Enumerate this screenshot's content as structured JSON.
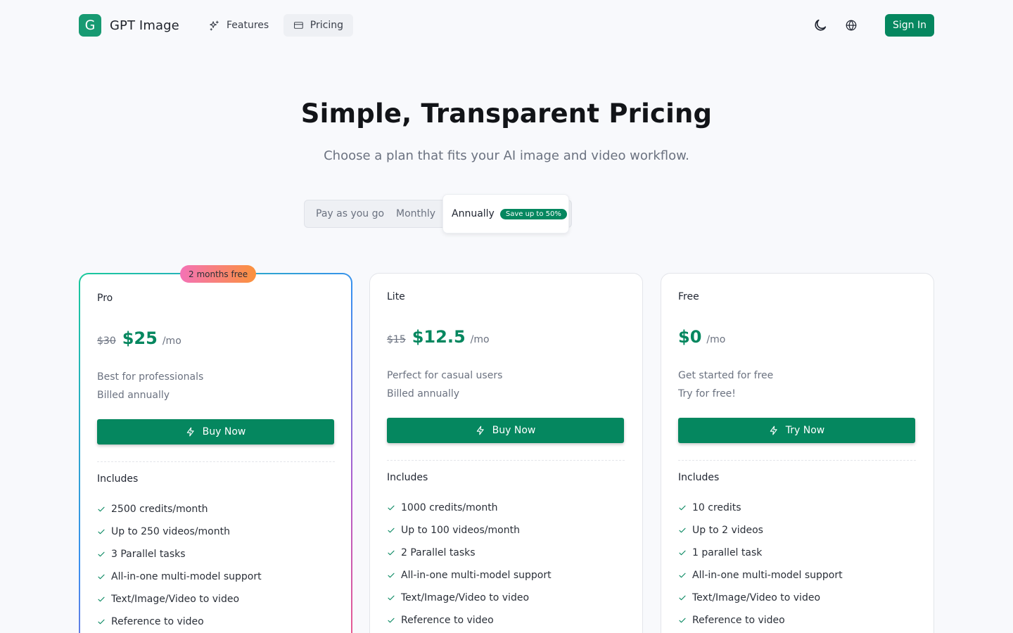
{
  "header": {
    "logo_letter": "G",
    "app_name": "GPT Image",
    "nav": {
      "features": "Features",
      "pricing": "Pricing"
    },
    "theme_icon": "moon-icon",
    "language_icon": "globe-icon",
    "sign_in": "Sign In"
  },
  "hero": {
    "title": "Simple, Transparent Pricing",
    "subtitle": "Choose a plan that fits your AI image and video workflow."
  },
  "billing": {
    "pay_as_you_go": "Pay as you go",
    "monthly": "Monthly",
    "annually": "Annually",
    "save_badge": "Save up to 50%",
    "selected": "Annually"
  },
  "plans": {
    "pro": {
      "badge": "2 months free",
      "name": "Pro",
      "old_price": "$30",
      "price": "$25",
      "per": "/mo",
      "desc1": "Best for professionals",
      "desc2": "Billed annually",
      "cta": "Buy Now",
      "includes": "Includes",
      "features": [
        "2500 credits/month",
        "Up to 250 videos/month",
        "3 Parallel tasks",
        "All-in-one multi-model support",
        "Text/Image/Video to video",
        "Reference to video"
      ]
    },
    "lite": {
      "name": "Lite",
      "old_price": "$15",
      "price": "$12.5",
      "per": "/mo",
      "desc1": "Perfect for casual users",
      "desc2": "Billed annually",
      "cta": "Buy Now",
      "includes": "Includes",
      "features": [
        "1000 credits/month",
        "Up to 100 videos/month",
        "2 Parallel tasks",
        "All-in-one multi-model support",
        "Text/Image/Video to video",
        "Reference to video"
      ]
    },
    "free": {
      "name": "Free",
      "price": "$0",
      "per": "/mo",
      "desc1": "Get started for free",
      "desc2": "Try for free!",
      "cta": "Try Now",
      "includes": "Includes",
      "features": [
        "10 credits",
        "Up to 2 videos",
        "1 parallel task",
        "All-in-one multi-model support",
        "Text/Image/Video to video",
        "Reference to video"
      ]
    }
  },
  "colors": {
    "brand": "#05875f",
    "background": "#f8f9fc",
    "muted_text": "#6b7280"
  }
}
